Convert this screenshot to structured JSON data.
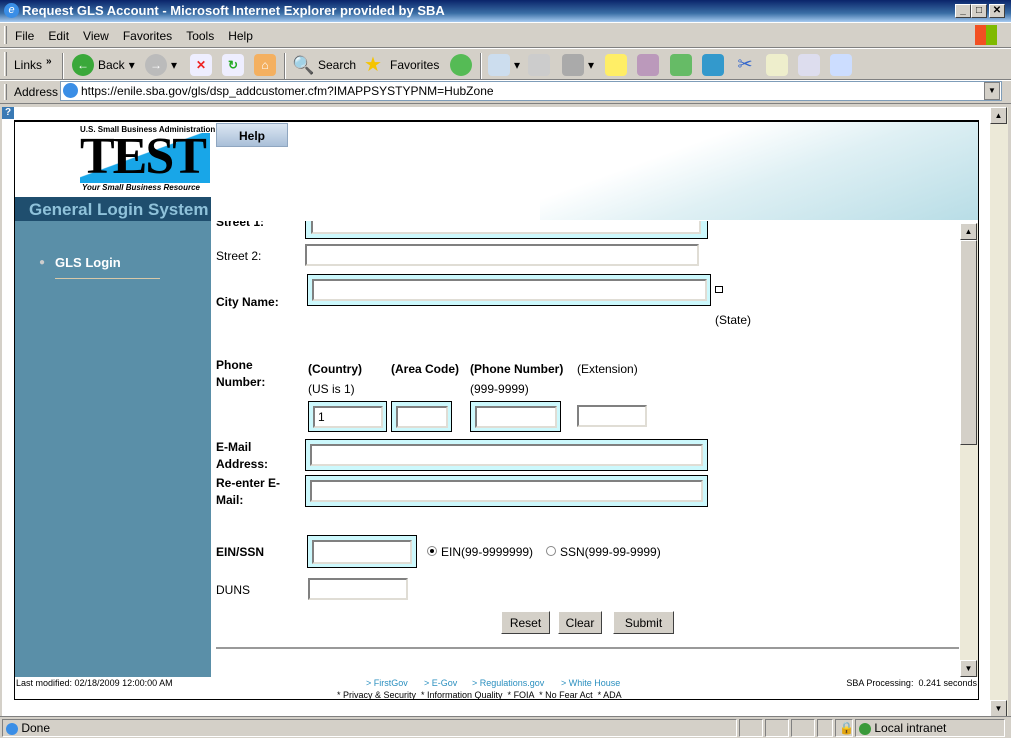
{
  "window": {
    "title": "Request GLS Account - Microsoft Internet Explorer provided by SBA",
    "min": "_",
    "max": "□",
    "close": "✕"
  },
  "menu": [
    "File",
    "Edit",
    "View",
    "Favorites",
    "Tools",
    "Help"
  ],
  "toolbar": {
    "links": "Links",
    "back": "Back",
    "search": "Search",
    "favorites": "Favorites"
  },
  "address": {
    "label": "Address",
    "url": "https://enile.sba.gov/gls/dsp_addcustomer.cfm?IMAPPSYSTYPNM=HubZone"
  },
  "logo": {
    "top": "U.S. Small Business Administration",
    "main": "TEST",
    "tagline": "Your Small Business Resource"
  },
  "help_button": "Help",
  "system_title": "General Login System",
  "sidebar": {
    "items": [
      {
        "label": "GLS Login"
      }
    ]
  },
  "form": {
    "street1_label": "Street 1:",
    "street2_label": "Street 2:",
    "city_label": "City Name:",
    "state_label": "(State)",
    "phone_label_1": "Phone",
    "phone_label_2": "Number:",
    "country_label": "(Country)",
    "country_hint": "(US is 1)",
    "area_label": "(Area Code)",
    "number_label": "(Phone Number)",
    "number_hint": "(999-9999)",
    "ext_label": "(Extension)",
    "country_value": "1",
    "email_label_1": "E-Mail",
    "email_label_2": "Address:",
    "reemail_label_1": "Re-enter E-",
    "reemail_label_2": "Mail:",
    "einssn_label": "EIN/SSN",
    "ein_option": "EIN(99-9999999)",
    "ssn_option": "SSN(999-99-9999)",
    "selected": "EIN",
    "duns_label": "DUNS",
    "reset": "Reset",
    "clear": "Clear",
    "submit": "Submit"
  },
  "footer": {
    "last_modified": "Last modified: 02/18/2009 12:00:00 AM",
    "links": [
      "> FirstGov",
      "> E-Gov",
      "> Regulations.gov",
      "> White House"
    ],
    "bottom": "* Privacy & Security  * Information Quality  * FOIA  * No Fear Act  * ADA",
    "processing": "SBA Processing:  0.241 seconds"
  },
  "statusbar": {
    "text": "Done",
    "zone": "Local intranet"
  }
}
